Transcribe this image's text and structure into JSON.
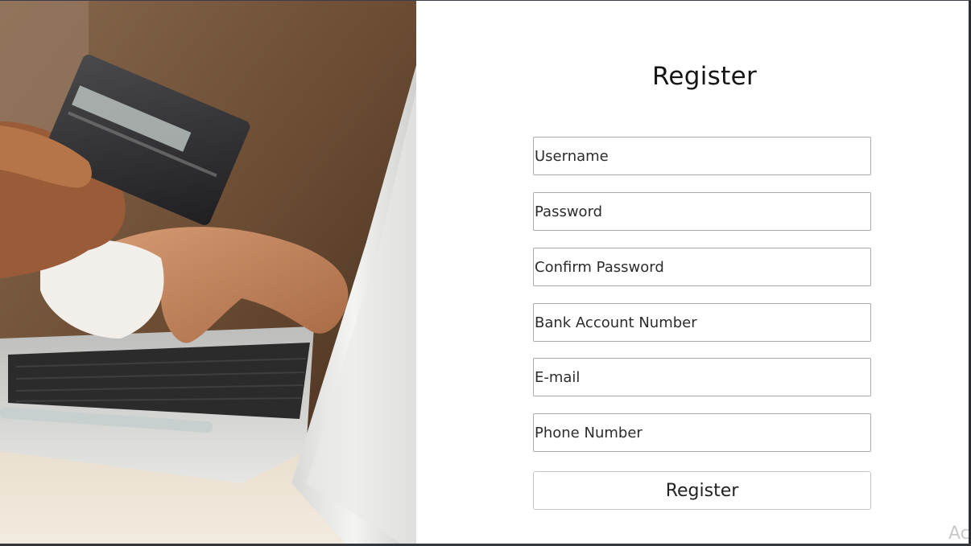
{
  "register_page": {
    "title": "Register",
    "fields": {
      "username_placeholder": "Username",
      "password_placeholder": "Password",
      "confirm_password_placeholder": "Confirm Password",
      "bank_account_placeholder": "Bank Account Number",
      "email_placeholder": "E-mail",
      "phone_placeholder": "Phone Number"
    },
    "submit_label": "Register"
  },
  "photo": {
    "subject": "hand holding credit card while typing on laptop"
  },
  "watermark": {
    "text": "Ac"
  },
  "colors": {
    "panel_bg": "#ffffff",
    "field_border": "#a9a9a9",
    "button_border": "#c4c4c4",
    "photo_warm": "#6a4a31"
  }
}
